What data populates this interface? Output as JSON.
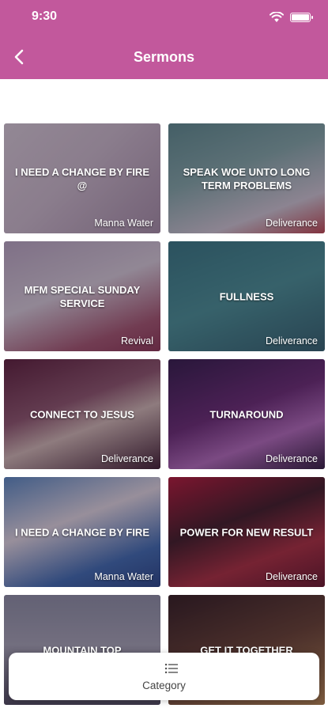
{
  "status_bar": {
    "time": "9:30"
  },
  "header": {
    "title": "Sermons",
    "back_icon": "chevron-left-icon"
  },
  "colors": {
    "appbar": "#c2589c",
    "text_light": "#ffffff"
  },
  "sermons": [
    {
      "title": "I NEED A CHANGE BY FIRE @",
      "category": "Manna Water"
    },
    {
      "title": "SPEAK WOE UNTO LONG TERM PROBLEMS",
      "category": "Deliverance"
    },
    {
      "title": "MFM SPECIAL SUNDAY SERVICE",
      "category": "Revival"
    },
    {
      "title": "FULLNESS",
      "category": "Deliverance"
    },
    {
      "title": "CONNECT TO JESUS",
      "category": "Deliverance"
    },
    {
      "title": "TURNAROUND",
      "category": "Deliverance"
    },
    {
      "title": "I NEED A CHANGE BY FIRE",
      "category": "Manna Water"
    },
    {
      "title": "POWER FOR NEW RESULT",
      "category": "Deliverance"
    },
    {
      "title": "MOUNTAIN TOP",
      "category": ""
    },
    {
      "title": "GET IT TOGETHER",
      "category": ""
    }
  ],
  "category_bar": {
    "label": "Category",
    "icon": "list-icon"
  }
}
